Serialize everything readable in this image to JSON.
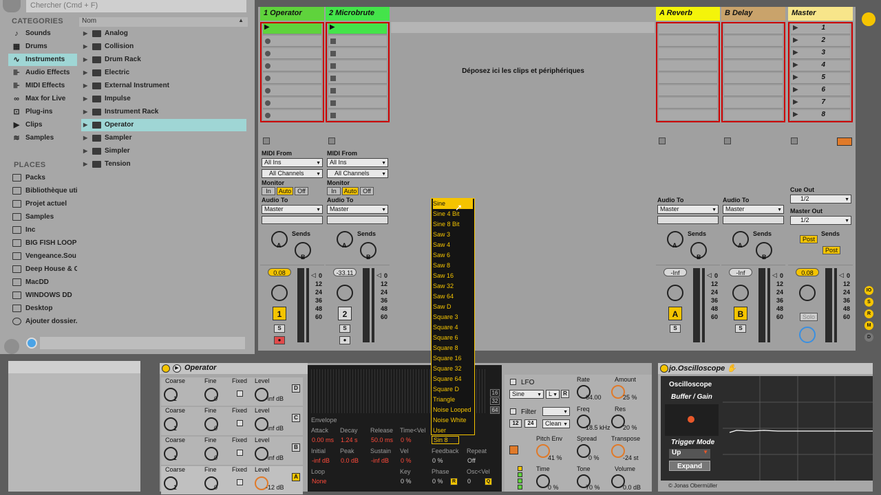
{
  "browser": {
    "search_placeholder": "Chercher (Cmd + F)",
    "categories_title": "CATEGORIES",
    "categories": [
      {
        "label": "Sounds",
        "icon": "note-icon"
      },
      {
        "label": "Drums",
        "icon": "grid-icon"
      },
      {
        "label": "Instruments",
        "icon": "wave-icon"
      },
      {
        "label": "Audio Effects",
        "icon": "audio-effects-icon"
      },
      {
        "label": "MIDI Effects",
        "icon": "midi-effects-icon"
      },
      {
        "label": "Max for Live",
        "icon": "max-icon"
      },
      {
        "label": "Plug-ins",
        "icon": "plugin-icon"
      },
      {
        "label": "Clips",
        "icon": "clip-icon"
      },
      {
        "label": "Samples",
        "icon": "sample-icon"
      }
    ],
    "name_column": "Nom",
    "items": [
      "Analog",
      "Collision",
      "Drum Rack",
      "Electric",
      "External Instrument",
      "Impulse",
      "Instrument Rack",
      "Operator",
      "Sampler",
      "Simpler",
      "Tension"
    ],
    "places_title": "PLACES",
    "places": [
      "Packs",
      "Bibliothèque uti",
      "Projet actuel",
      "Samples",
      "Inc",
      "BIG FISH LOOP",
      "Vengeance.Sou",
      "Deep House & C",
      "MacDD",
      "WINDOWS DD",
      "Desktop",
      "Ajouter dossier..."
    ]
  },
  "session": {
    "tracks": [
      {
        "name": "1 Operator",
        "color": "#5fd33c"
      },
      {
        "name": "2 Microbrute",
        "color": "#44e44a"
      },
      {
        "name": "A Reverb",
        "color": "#f4f40a"
      },
      {
        "name": "B Delay",
        "color": "#c9a36b"
      },
      {
        "name": "Master",
        "color": "#f7e58a"
      }
    ],
    "drop_message": "Déposez ici les clips et périphériques",
    "scenes": [
      "1",
      "2",
      "3",
      "4",
      "5",
      "6",
      "7",
      "8"
    ],
    "midi_from": "MIDI From",
    "all_ins": "All Ins",
    "all_channels": "All Channels",
    "monitor": "Monitor",
    "monitor_in": "In",
    "monitor_auto": "Auto",
    "monitor_off": "Off",
    "audio_to": "Audio To",
    "master": "Master",
    "sends": "Sends",
    "send_a": "A",
    "send_b": "B",
    "cue_out": "Cue Out",
    "cue_value": "1/2",
    "master_out": "Master Out",
    "master_out_value": "1/2",
    "post": "Post",
    "vol_values": [
      "0.08",
      "-33.11",
      "-Inf",
      "-Inf",
      "0.08"
    ],
    "scale": [
      "0",
      "12",
      "24",
      "36",
      "48",
      "60"
    ],
    "track_numbers": [
      "1",
      "2",
      "A",
      "B"
    ],
    "solo": "S",
    "solo_label": "Solo"
  },
  "operator": {
    "title": "Operator",
    "headers": [
      "Coarse",
      "Fine",
      "Fixed",
      "Level"
    ],
    "rows": [
      {
        "coarse": "1",
        "fine": "0",
        "level": "-inf dB",
        "osc": "D"
      },
      {
        "coarse": "1",
        "fine": "0",
        "level": "-inf dB",
        "osc": "C"
      },
      {
        "coarse": "1",
        "fine": "0",
        "level": "-inf dB",
        "osc": "B"
      },
      {
        "coarse": "1",
        "fine": "0",
        "level": "-12 dB",
        "osc": "A"
      }
    ],
    "envelope": {
      "label": "Envelope",
      "ranges": [
        "16",
        "32",
        "64"
      ],
      "attack": "Attack",
      "attack_v": "0.00 ms",
      "decay": "Decay",
      "decay_v": "1.24 s",
      "release": "Release",
      "release_v": "50.0 ms",
      "timevel": "Time<Vel",
      "timevel_v": "0 %",
      "initial": "Initial",
      "initial_v": "-inf dB",
      "peak": "Peak",
      "peak_v": "0.0 dB",
      "sustain": "Sustain",
      "sustain_v": "-inf dB",
      "vel": "Vel",
      "vel_v": "0 %",
      "wave": "Sin 8",
      "feedback": "Feedback",
      "feedback_v": "0 %",
      "repeat": "Repeat",
      "repeat_v": "Off",
      "loop": "Loop",
      "loop_v": "None",
      "key": "Key",
      "key_v": "0 %",
      "phase": "Phase",
      "phase_v": "0 %",
      "oscvel": "Osc<Vel",
      "oscvel_v": "0",
      "r": "R",
      "q": "Q"
    },
    "lfo": {
      "label": "LFO",
      "wave": "Sine",
      "mode": "L",
      "r": "R",
      "rate": "Rate",
      "rate_v": "64.00",
      "amount": "Amount",
      "amount_v": "25 %"
    },
    "filter": {
      "label": "Filter",
      "n12": "12",
      "n24": "24",
      "type": "Clean",
      "freq": "Freq",
      "freq_v": "18.5 kHz",
      "res": "Res",
      "res_v": "20 %"
    },
    "pitch": {
      "label": "Pitch Env",
      "value": "41 %",
      "spread": "Spread",
      "spread_v": "0 %",
      "transpose": "Transpose",
      "transpose_v": "-24 st"
    },
    "out": {
      "time": "Time",
      "time_v": "0 %",
      "tone": "Tone",
      "tone_v": "70 %",
      "volume": "Volume",
      "volume_v": "0.0 dB"
    }
  },
  "waveform_menu": {
    "items": [
      "Sine",
      "Sine 4 Bit",
      "Sine 8 Bit",
      "Saw 3",
      "Saw 4",
      "Saw 6",
      "Saw 8",
      "Saw 16",
      "Saw 32",
      "Saw 64",
      "Saw D",
      "Square 3",
      "Square 4",
      "Square 6",
      "Square 8",
      "Square 16",
      "Square 32",
      "Square 64",
      "Square D",
      "Triangle",
      "Noise Looped",
      "Noise White",
      "User"
    ],
    "selected": 0
  },
  "oscilloscope": {
    "title": "jo.Oscilloscope",
    "panel_title": "Oscilloscope",
    "buffer_gain": "Buffer / Gain",
    "trigger_mode": "Trigger Mode",
    "trigger_value": "Up",
    "expand": "Expand",
    "credit": "© Jonas Obermüller"
  },
  "side_buttons": [
    "IO",
    "S",
    "R",
    "M",
    "D"
  ]
}
